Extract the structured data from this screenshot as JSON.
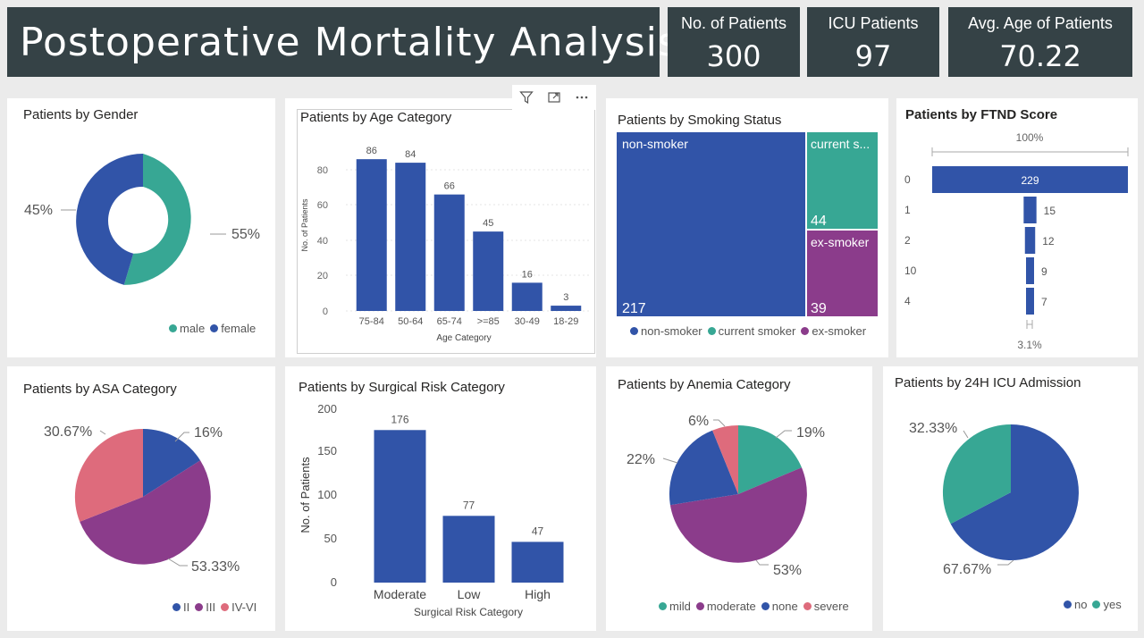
{
  "header": {
    "title": "Postoperative Mortality Analysis"
  },
  "kpis": [
    {
      "label": "No. of Patients",
      "value": "300"
    },
    {
      "label": "ICU Patients",
      "value": "97"
    },
    {
      "label": "Avg. Age of Patients",
      "value": "70.22"
    }
  ],
  "toolbar": {
    "icons": [
      "filter-icon",
      "focus-mode-icon",
      "more-options-icon"
    ]
  },
  "colors": {
    "teal": "#37a794",
    "blue": "#3154a8",
    "purple": "#8b3c8b",
    "pink": "#de6b7c",
    "header_bg": "#354246"
  },
  "gender": {
    "title": "Patients by Gender",
    "legend": [
      "male",
      "female"
    ],
    "chart_data": {
      "type": "pie",
      "donut": true,
      "labels": [
        "male",
        "female"
      ],
      "values": [
        55,
        45
      ],
      "data_labels": [
        "55%",
        "45%"
      ]
    }
  },
  "age": {
    "title": "Patients by Age Category",
    "chart_data": {
      "type": "bar",
      "categories": [
        "75-84",
        "50-64",
        "65-74",
        ">=85",
        "30-49",
        "18-29"
      ],
      "values": [
        86,
        84,
        66,
        45,
        16,
        3
      ],
      "xlabel": "Age Category",
      "ylabel": "No. of Patients",
      "ylim": [
        0,
        90
      ],
      "yticks": [
        0,
        20,
        40,
        60,
        80
      ]
    }
  },
  "smoking": {
    "title": "Patients by Smoking Status",
    "legend": [
      "non-smoker",
      "current smoker",
      "ex-smoker"
    ],
    "chart_data": {
      "type": "treemap",
      "labels": [
        "non-smoker",
        "current s...",
        "ex-smoker"
      ],
      "values": [
        217,
        44,
        39
      ]
    }
  },
  "ftnd": {
    "title": "Patients by FTND Score",
    "top_label": "100%",
    "bottom_label": "3.1%",
    "chart_data": {
      "type": "funnel",
      "categories": [
        "0",
        "1",
        "2",
        "10",
        "4"
      ],
      "values": [
        229,
        15,
        12,
        9,
        7
      ]
    }
  },
  "asa": {
    "title": "Patients by ASA Category",
    "legend": [
      "II",
      "III",
      "IV-VI"
    ],
    "chart_data": {
      "type": "pie",
      "labels": [
        "II",
        "III",
        "IV-VI"
      ],
      "values": [
        16,
        53.33,
        30.67
      ],
      "data_labels": [
        "16%",
        "53.33%",
        "30.67%"
      ]
    }
  },
  "surgical": {
    "title": "Patients by Surgical Risk Category",
    "chart_data": {
      "type": "bar",
      "categories": [
        "Moderate",
        "Low",
        "High"
      ],
      "values": [
        176,
        77,
        47
      ],
      "xlabel": "Surgical Risk Category",
      "ylabel": "No. of Patients",
      "ylim": [
        0,
        200
      ],
      "yticks": [
        0,
        50,
        100,
        150,
        200
      ]
    }
  },
  "anemia": {
    "title": "Patients by Anemia Category",
    "legend": [
      "mild",
      "moderate",
      "none",
      "severe"
    ],
    "chart_data": {
      "type": "pie",
      "labels": [
        "mild",
        "moderate",
        "none",
        "severe"
      ],
      "values": [
        19,
        53,
        22,
        6
      ],
      "data_labels": [
        "19%",
        "53%",
        "22%",
        "6%"
      ]
    }
  },
  "icu": {
    "title": "Patients by 24H ICU Admission",
    "legend": [
      "no",
      "yes"
    ],
    "chart_data": {
      "type": "pie",
      "labels": [
        "no",
        "yes"
      ],
      "values": [
        67.67,
        32.33
      ],
      "data_labels": [
        "67.67%",
        "32.33%"
      ]
    }
  }
}
